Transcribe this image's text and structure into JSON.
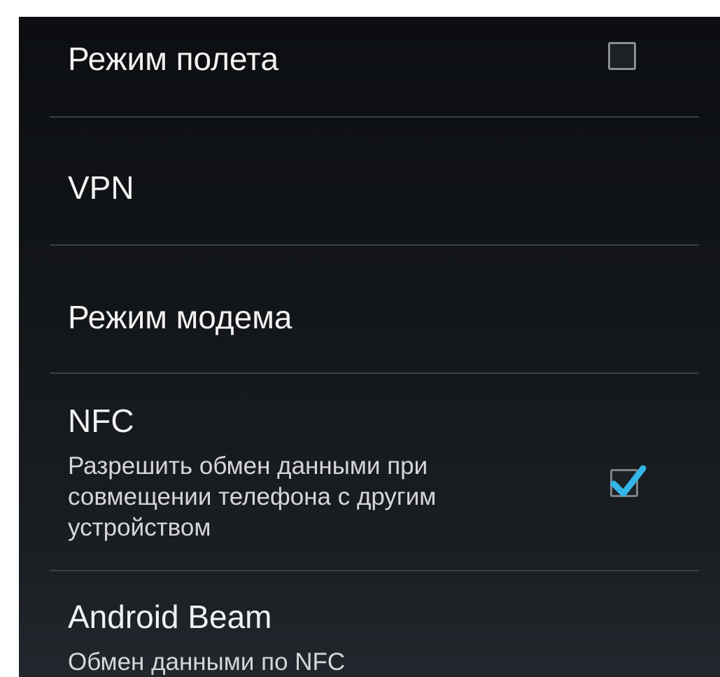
{
  "settings": {
    "items": [
      {
        "title": "Режим полета",
        "checkbox": "unchecked"
      },
      {
        "title": "VPN"
      },
      {
        "title": "Режим модема"
      },
      {
        "title": "NFC",
        "summary": "Разрешить обмен данными при совмещении телефона с другим устройством",
        "checkbox": "checked"
      },
      {
        "title": "Android Beam",
        "summary": "Обмен данными по NFC"
      }
    ]
  },
  "colors": {
    "accent": "#33b5e5",
    "background": "#15181c",
    "divider": "#3b4046"
  },
  "icons": {
    "checkmark": "check-icon"
  }
}
